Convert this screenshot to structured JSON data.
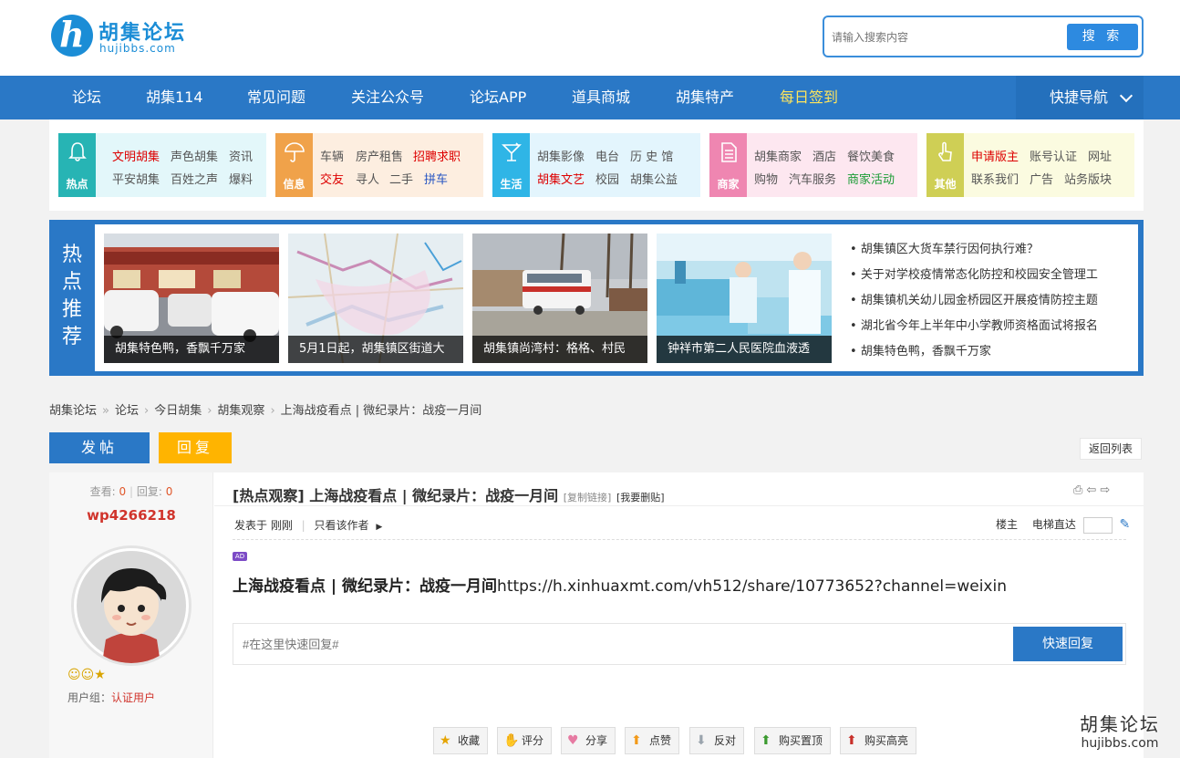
{
  "header": {
    "logo_name": "胡集论坛",
    "logo_url": "hujibbs.com",
    "search_placeholder": "请输入搜索内容",
    "search_button": "搜 索"
  },
  "nav": {
    "items": [
      "论坛",
      "胡集114",
      "常见问题",
      "关注公众号",
      "论坛APP",
      "道具商城",
      "胡集特产",
      "每日签到"
    ],
    "quick_nav": "快捷导航"
  },
  "categories": [
    {
      "label": "热点",
      "icon": "bell-icon",
      "color": "#27b4b4",
      "bg": "#e3f7fa",
      "links": [
        "文明胡集",
        "声色胡集",
        "资讯",
        "平安胡集",
        "百姓之声",
        "爆料"
      ]
    },
    {
      "label": "信息",
      "icon": "umbrella-icon",
      "color": "#f0a24a",
      "bg": "#fdeee0",
      "links": [
        "车辆",
        "房产租售",
        "招聘求职",
        "交友",
        "寻人",
        "二手",
        "拼车"
      ]
    },
    {
      "label": "生活",
      "icon": "cocktail-icon",
      "color": "#2fb5e6",
      "bg": "#e3f5fd",
      "links": [
        "胡集影像",
        "电台",
        "历 史 馆",
        "胡集文艺",
        "校园",
        "胡集公益"
      ]
    },
    {
      "label": "商家",
      "icon": "document-icon",
      "color": "#ef86b1",
      "bg": "#fde7f0",
      "links": [
        "胡集商家",
        "酒店",
        "餐饮美食",
        "购物",
        "汽车服务",
        "商家活动"
      ]
    },
    {
      "label": "其他",
      "icon": "hand-pointer-icon",
      "color": "#cfcf55",
      "bg": "#fbfbe0",
      "links": [
        "申请版主",
        "账号认证",
        "网址",
        "联系我们",
        "广告",
        "站务版块"
      ]
    }
  ],
  "hot": {
    "title": [
      "热",
      "点",
      "推",
      "荐"
    ],
    "pics": [
      {
        "caption": "胡集特色鸭，香飘千万家"
      },
      {
        "caption": "5月1日起，胡集镇区街道大"
      },
      {
        "caption": "胡集镇尚湾村：格格、村民"
      },
      {
        "caption": "钟祥市第二人民医院血液透"
      }
    ],
    "list": [
      "胡集镇区大货车禁行因何执行难？",
      "关于对学校疫情常态化防控和校园安全管理工",
      "胡集镇机关幼儿园金桥园区开展疫情防控主题",
      "湖北省今年上半年中小学教师资格面试将报名",
      "胡集特色鸭，香飘千万家"
    ]
  },
  "breadcrumb": [
    "胡集论坛",
    "论坛",
    "今日胡集",
    "胡集观察",
    "上海战疫看点 | 微纪录片：战疫一月间"
  ],
  "buttons": {
    "post": "发帖",
    "reply": "回复",
    "back": "返回列表"
  },
  "post": {
    "views_label": "查看:",
    "views": "0",
    "replies_label": "回复:",
    "replies": "0",
    "author": "wp4266218",
    "usergroup_label": "用户组：",
    "usergroup": "认证用户",
    "title": "[热点观察] 上海战疫看点 | 微纪录片：战疫一月间",
    "copy_link": "[复制链接]",
    "delete": "[我要删贴]",
    "posted": "发表于 刚刚",
    "only_author": "只看该作者",
    "floor": "楼主",
    "elevator": "电梯直达",
    "ad": "AD",
    "content_bold": "上海战疫看点 | 微纪录片：战疫一月间",
    "content_url": "https://h.xinhuaxmt.com/vh512/share/10773652?channel=weixin",
    "quick_reply_placeholder": "#在这里快速回复#",
    "quick_reply_button": "快速回复",
    "actions": [
      "收藏",
      "评分",
      "分享",
      "点赞",
      "反对",
      "购买置顶",
      "购买高亮"
    ]
  },
  "watermark": {
    "name": "胡集论坛",
    "url": "hujibbs.com"
  }
}
